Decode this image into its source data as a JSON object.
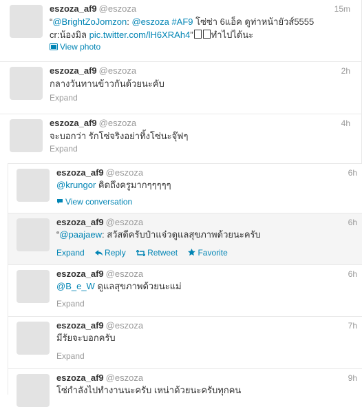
{
  "tweets": [
    {
      "fullname": "eszoza_af9",
      "username": "@eszoza",
      "time": "15m",
      "line1": [
        {
          "t": "“",
          "link": false
        },
        {
          "t": "@BrightZoJomzon",
          "link": true
        },
        {
          "t": ": ",
          "link": false
        },
        {
          "t": "@eszoza",
          "link": true
        },
        {
          "t": " ",
          "link": false
        },
        {
          "t": "#AF9",
          "link": true
        },
        {
          "t": " โซ่ซ่า 6แอ็ค ดูท่าหน้ายัวส์5555",
          "link": false
        }
      ],
      "line2": [
        {
          "t": "cr:น้องมิล ",
          "link": false
        },
        {
          "t": "pic.twitter.com/lH6XRAh4",
          "link": true
        },
        {
          "t": "”",
          "link": false
        }
      ],
      "line2_tail": "ทำไปได้นะ",
      "action_label": "View photo",
      "action_icon": "photo-icon"
    },
    {
      "fullname": "eszoza_af9",
      "username": "@eszoza",
      "time": "2h",
      "line1": [
        {
          "t": "กลางวันทานข้าวกันด้วยนะคับ",
          "link": false
        }
      ],
      "action_label": "Expand"
    },
    {
      "fullname": "eszoza_af9",
      "username": "@eszoza",
      "time": "4h",
      "line1": [
        {
          "t": "จะบอกว่า รักโซ่จริงอย่าทิ้งโซ่นะจุ๊ฟๆ",
          "link": false
        }
      ],
      "action_label": "Expand"
    },
    {
      "fullname": "eszoza_af9",
      "username": "@eszoza",
      "time": "6h",
      "line1": [
        {
          "t": "@krungor",
          "link": true
        },
        {
          "t": " คิดถึงครูมากๆๆๆๆๆ",
          "link": false
        }
      ],
      "action_label": "View conversation",
      "action_icon": "speech-bubble-icon"
    },
    {
      "fullname": "eszoza_af9",
      "username": "@eszoza",
      "time": "6h",
      "line1": [
        {
          "t": "“",
          "link": false
        },
        {
          "t": "@paajaew",
          "link": true
        },
        {
          "t": ": สวัสดีครับป๋าแจ๋วดูแลสุขภาพด้วยนะครับ",
          "link": false
        }
      ],
      "actions": {
        "expand": "Expand",
        "reply": "Reply",
        "retweet": "Retweet",
        "favorite": "Favorite"
      }
    },
    {
      "fullname": "eszoza_af9",
      "username": "@eszoza",
      "time": "6h",
      "line1": [
        {
          "t": "@B_e_W",
          "link": true
        },
        {
          "t": " ดูแลสุขภาพด้วยนะแม่",
          "link": false
        }
      ],
      "action_label": "Expand"
    },
    {
      "fullname": "eszoza_af9",
      "username": "@eszoza",
      "time": "7h",
      "line1": [
        {
          "t": "มีรัยจะบอกครับ",
          "link": false
        }
      ],
      "action_label": "Expand"
    },
    {
      "fullname": "eszoza_af9",
      "username": "@eszoza",
      "time": "9h",
      "line1": [
        {
          "t": "โซ่กำลังไปทำงานนะครับ เหน่าด้วยนะครับทุกคน",
          "link": false
        }
      ]
    }
  ],
  "colors": {
    "link": "#0084b4",
    "meta": "#999999",
    "text": "#333333",
    "highlight": "#f5f5f5"
  }
}
